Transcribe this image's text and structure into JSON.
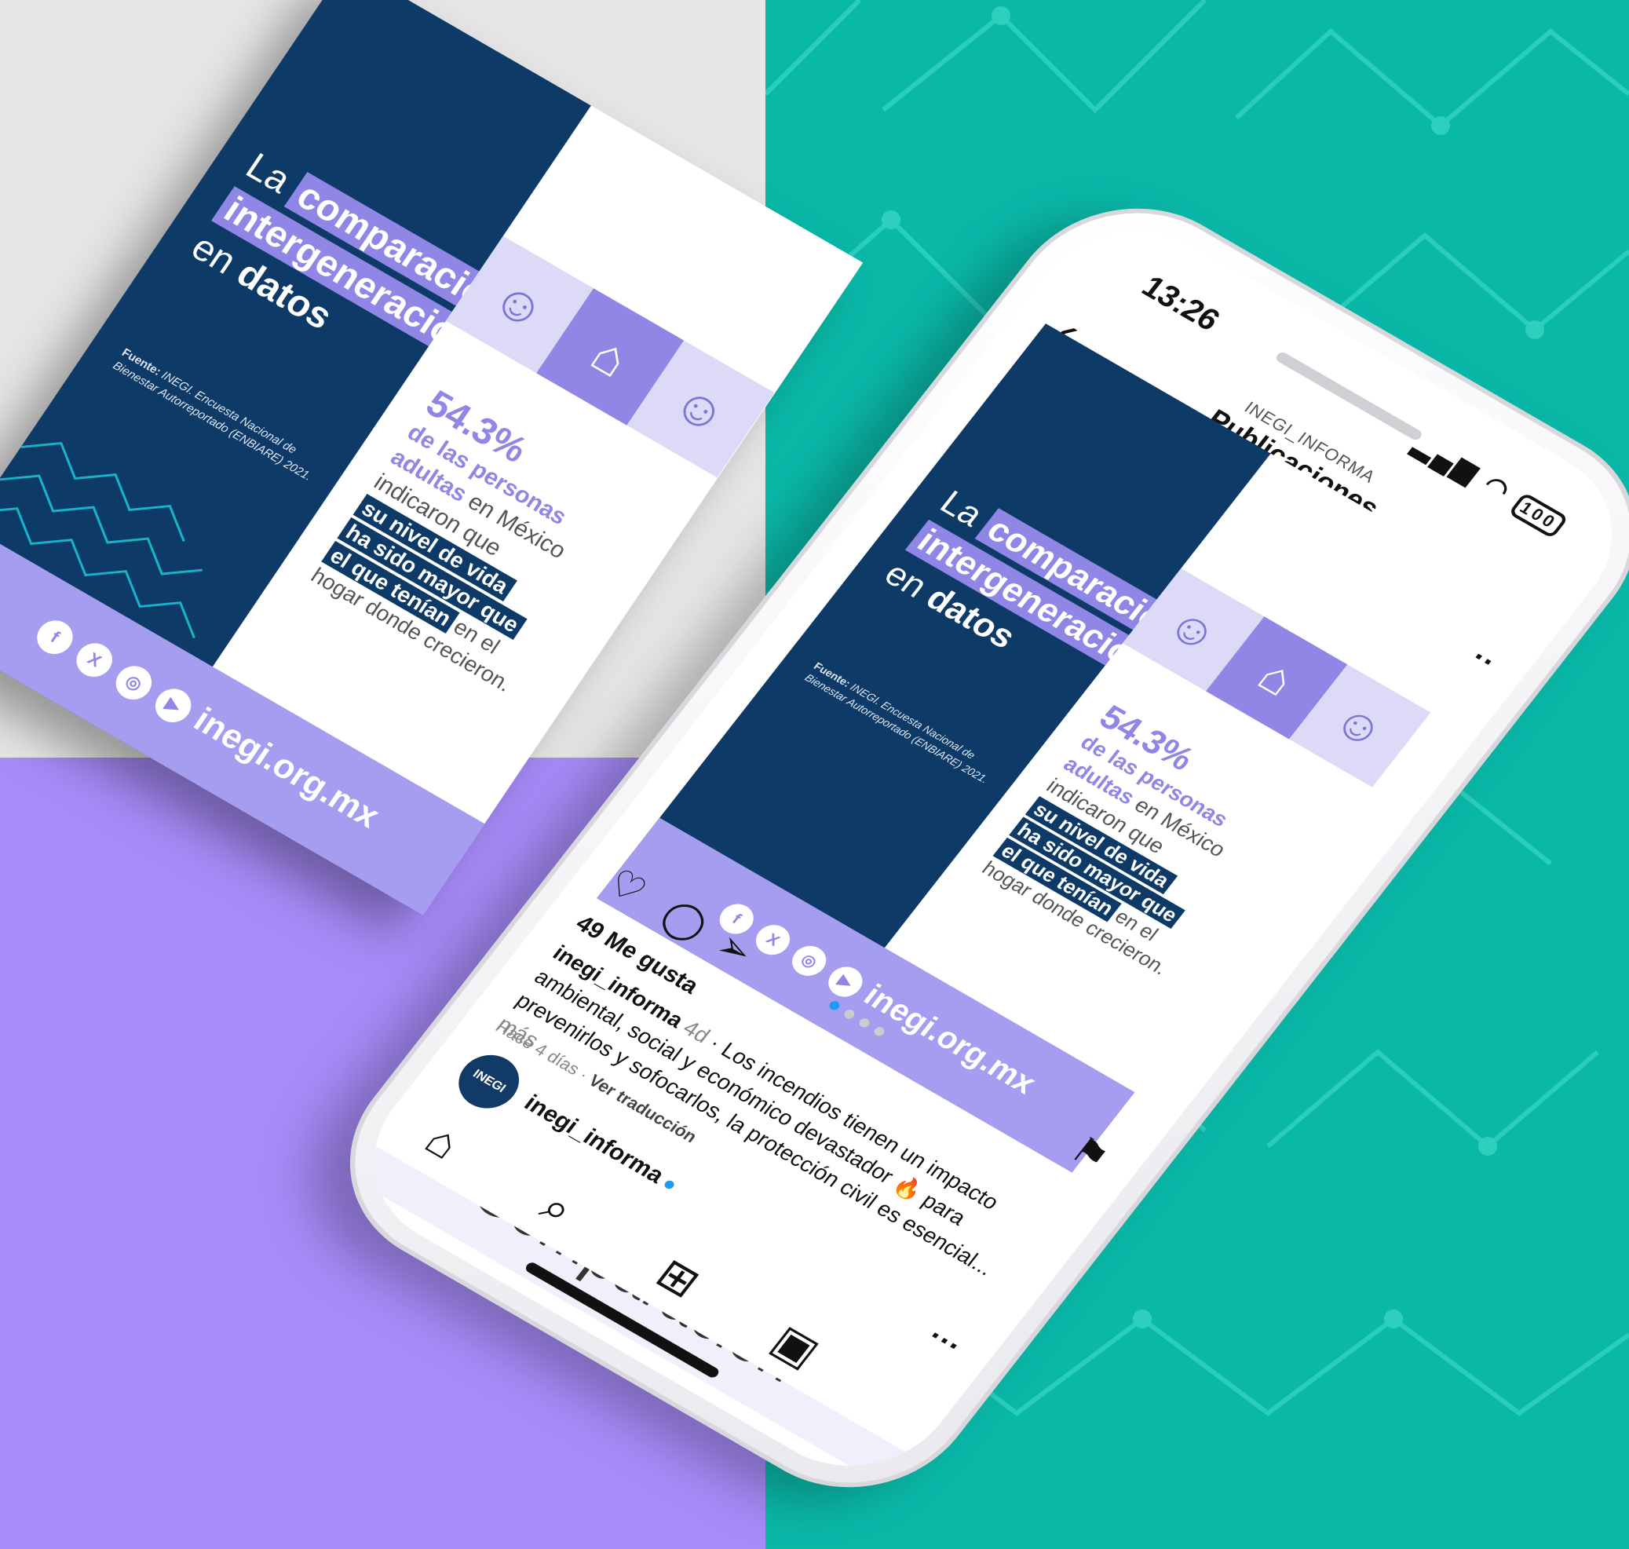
{
  "card": {
    "title_pre": "La",
    "title_hl1": "comparación",
    "title_hl2": "intergeneracional",
    "title_en": "en",
    "title_datos": "datos",
    "source_label": "Fuente:",
    "source_text": "INEGI. Encuesta Nacional de Bienestar Autorreportado (ENBIARE) 2021.",
    "stat_value": "54.3%",
    "stat_line1": "de las personas",
    "stat_line2a": "adultas",
    "stat_line2b": "en México",
    "stat_line3": "indicaron que",
    "bar1": "su nivel de vida",
    "bar2": "ha sido mayor que",
    "bar3a": "el que tenían",
    "bar3b": "en el",
    "stat_end": "hogar donde crecieron.",
    "url": "inegi.org.mx",
    "social": [
      "f",
      "X",
      "◎",
      "▶"
    ],
    "icons": [
      "person-icon",
      "house-icon",
      "woman-icon"
    ]
  },
  "phone": {
    "time": "13:26",
    "battery": "100",
    "header_kicker": "INEGI_INFORMA",
    "header_title": "Publicaciones",
    "back": "‹",
    "avatar_text": "INEGI",
    "username": "inegi_informa",
    "verified": "●",
    "more": "···",
    "likes": "49 Me gusta",
    "caption_user": "inegi_informa",
    "caption_age": "4d",
    "caption_text": "· Los incendios tienen un impacto ambiental, social y económico devastador 🔥 para prevenirlos y sofocarlos, la protección civil es esencial...",
    "caption_more": "más",
    "meta_time": "Hace 4 días",
    "meta_translate": "Ver traducción",
    "next_username": "inegi_informa",
    "next_title": "Comparación",
    "tabs": [
      "⌂",
      "⌕",
      "⊞",
      "▣"
    ]
  },
  "colors": {
    "navy": "#0d3a66",
    "lavender": "#8f86e6",
    "teal": "#0ab8a8",
    "purple": "#a78bf8"
  }
}
